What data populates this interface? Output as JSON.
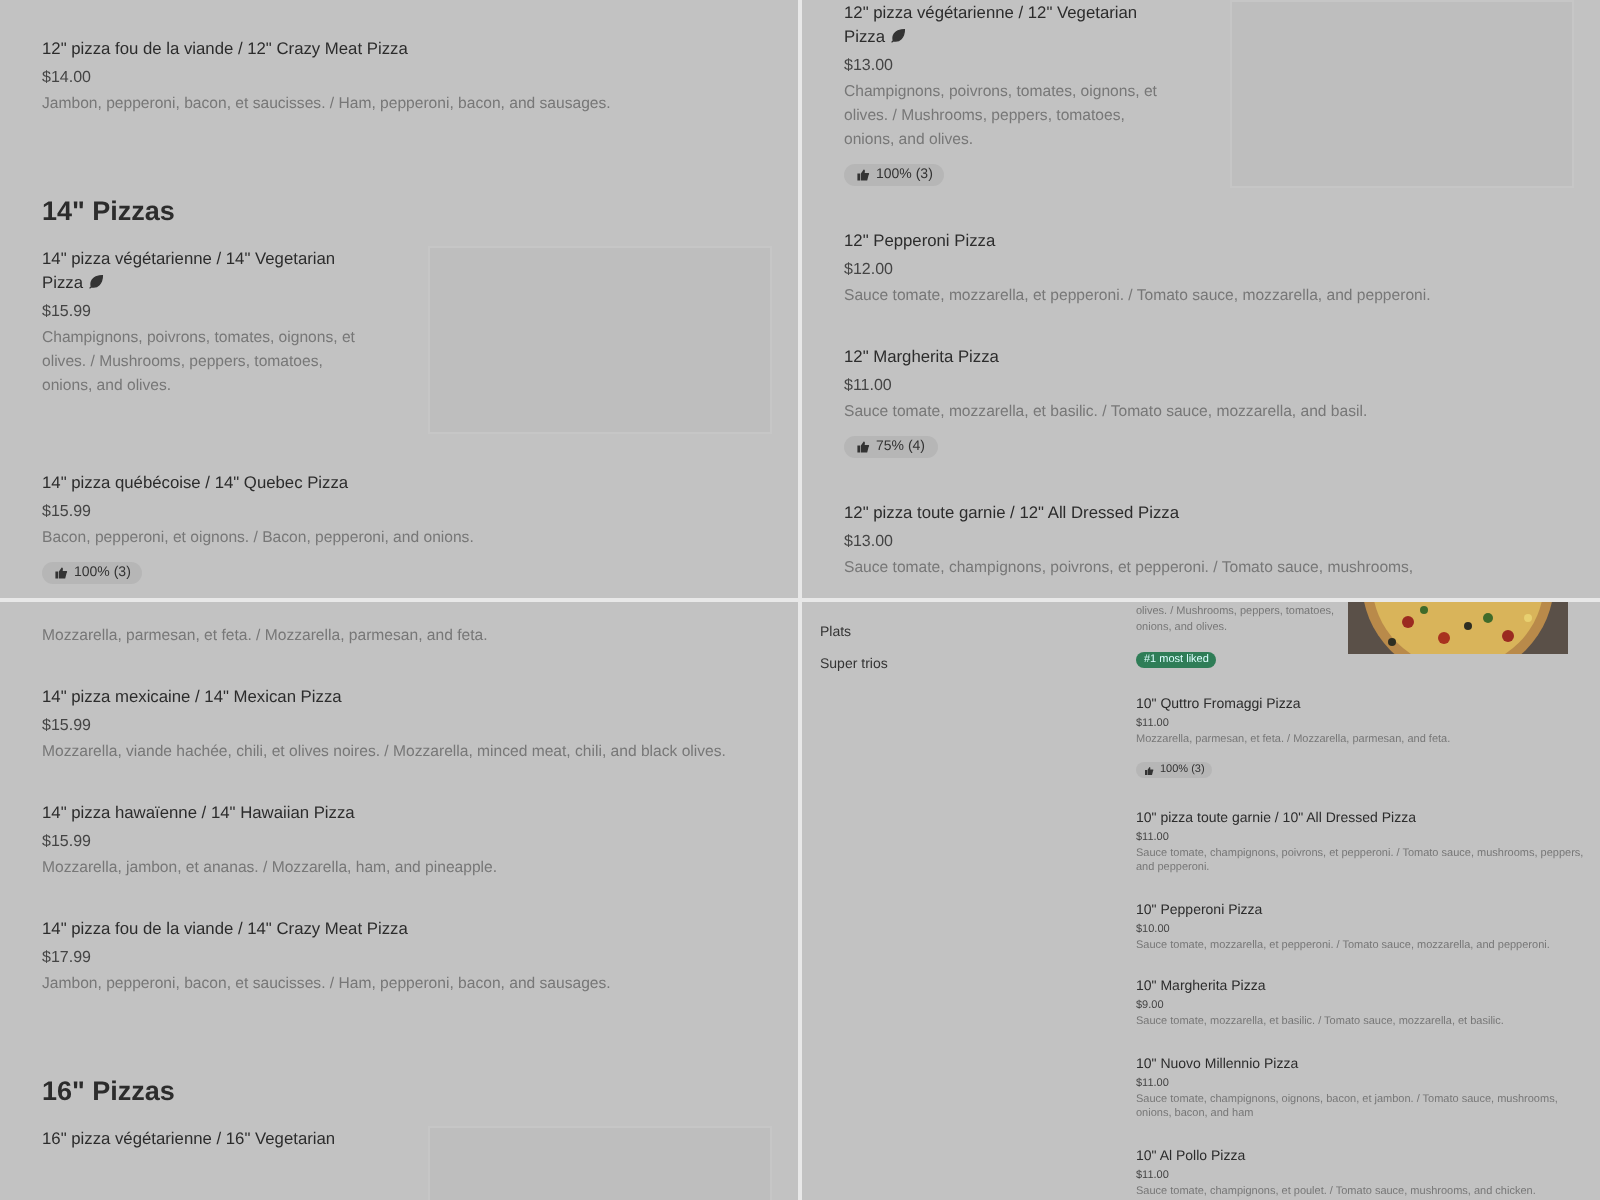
{
  "panels": [
    {
      "kind": "menu",
      "entries": [
        {
          "kind": "item",
          "name": "12\" pizza fou de la viande / 12\" Crazy Meat Pizza",
          "price": "$14.00",
          "description": "Jambon, pepperoni, bacon, et saucisses. / Ham, pepperoni, bacon, and sausages."
        },
        {
          "kind": "heading",
          "text": "14\" Pizzas"
        },
        {
          "kind": "imaged",
          "name": "14\" pizza végétarienne / 14\" Vegetarian Pizza",
          "price": "$15.99",
          "description": "Champignons, poivrons, tomates, oignons, et olives. / Mushrooms, peppers, tomatoes, onions, and olives.",
          "vegetarian": true
        },
        {
          "kind": "item",
          "name": "14\" pizza québécoise / 14\" Quebec Pizza",
          "price": "$15.99",
          "description": "Bacon, pepperoni, et oignons. / Bacon, pepperoni, and onions.",
          "rating": "100% (3)"
        }
      ]
    },
    {
      "kind": "menu",
      "entries": [
        {
          "kind": "imaged",
          "name": "12\" pizza végétarienne / 12\" Vegetarian Pizza",
          "price": "$13.00",
          "description": "Champignons, poivrons, tomates, oignons, et olives. / Mushrooms, peppers, tomatoes, onions, and olives.",
          "vegetarian": true,
          "rating": "100% (3)"
        },
        {
          "kind": "item",
          "name": "12\" Pepperoni Pizza",
          "price": "$12.00",
          "description": "Sauce tomate, mozzarella, et pepperoni. / Tomato sauce, mozzarella, and pepperoni."
        },
        {
          "kind": "item",
          "name": "12\" Margherita Pizza",
          "price": "$11.00",
          "description": "Sauce tomate, mozzarella, et basilic. / Tomato sauce, mozzarella, and basil.",
          "rating": "75% (4)"
        },
        {
          "kind": "item",
          "name": "12\" pizza toute garnie / 12\" All Dressed Pizza",
          "price": "$13.00",
          "description": "Sauce tomate, champignons, poivrons, et pepperoni. / Tomato sauce, mushrooms,"
        }
      ]
    },
    {
      "kind": "menu",
      "entries": [
        {
          "kind": "item",
          "description": "Mozzarella, parmesan, et feta. / Mozzarella, parmesan, and feta."
        },
        {
          "kind": "item",
          "name": "14\" pizza mexicaine / 14\" Mexican Pizza",
          "price": "$15.99",
          "description": "Mozzarella, viande hachée, chili, et olives noires. / Mozzarella, minced meat, chili, and black olives."
        },
        {
          "kind": "item",
          "name": "14\" pizza hawaïenne / 14\" Hawaiian Pizza",
          "price": "$15.99",
          "description": "Mozzarella, jambon, et ananas. / Mozzarella, ham, and pineapple."
        },
        {
          "kind": "item",
          "name": "14\" pizza fou de la viande / 14\" Crazy Meat Pizza",
          "price": "$17.99",
          "description": "Jambon, pepperoni, bacon, et saucisses. / Ham, pepperoni, bacon, and sausages."
        },
        {
          "kind": "heading",
          "text": "16\" Pizzas"
        },
        {
          "kind": "imaged",
          "name": "16\" pizza végétarienne / 16\" Vegetarian"
        }
      ]
    },
    {
      "kind": "compact",
      "sidebar": [
        "Plats",
        "Super trios"
      ],
      "entries": [
        {
          "kind": "pictured",
          "description": "olives. / Mushrooms, peppers, tomatoes, onions, and olives.",
          "badge": "#1 most liked"
        },
        {
          "kind": "item",
          "name": "10\" Quttro Fromaggi Pizza",
          "price": "$11.00",
          "description": "Mozzarella, parmesan, et feta. / Mozzarella, parmesan, and feta.",
          "rating": "100% (3)"
        },
        {
          "kind": "item",
          "name": "10\" pizza toute garnie / 10\" All Dressed Pizza",
          "price": "$11.00",
          "description": "Sauce tomate, champignons, poivrons, et pepperoni. / Tomato sauce, mushrooms, peppers, and pepperoni."
        },
        {
          "kind": "item",
          "name": "10\" Pepperoni Pizza",
          "price": "$10.00",
          "description": "Sauce tomate, mozzarella, et pepperoni. / Tomato sauce, mozzarella, and pepperoni."
        },
        {
          "kind": "item",
          "name": "10\" Margherita Pizza",
          "price": "$9.00",
          "description": "Sauce tomate, mozzarella, et basilic. / Tomato sauce, mozzarella, et basilic."
        },
        {
          "kind": "item",
          "name": "10\" Nuovo Millennio Pizza",
          "price": "$11.00",
          "description": "Sauce tomate, champignons, oignons, bacon, et jambon. / Tomato sauce, mushrooms, onions, bacon, and ham"
        },
        {
          "kind": "item",
          "name": "10\" Al Pollo Pizza",
          "price": "$11.00",
          "description": "Sauce tomate, champignons, et poulet. / Tomato sauce, mushrooms, and chicken."
        }
      ]
    }
  ]
}
